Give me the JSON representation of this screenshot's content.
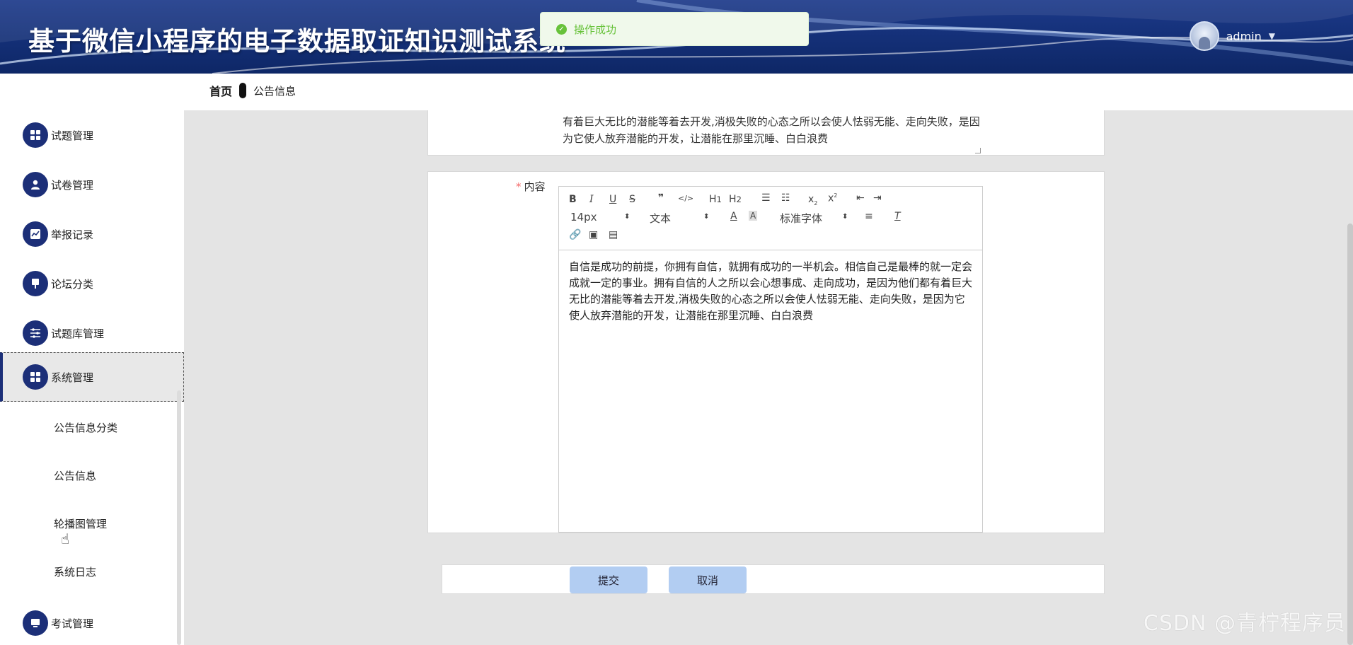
{
  "header": {
    "title": "基于微信小程序的电子数据取证知识测试系统",
    "username": "admin"
  },
  "toast": {
    "message": "操作成功"
  },
  "breadcrumb": {
    "home": "首页",
    "current": "公告信息"
  },
  "sidebar": {
    "items": [
      {
        "label": "试题管理",
        "icon": "grid-icon"
      },
      {
        "label": "试卷管理",
        "icon": "user-icon"
      },
      {
        "label": "举报记录",
        "icon": "chart-icon"
      },
      {
        "label": "论坛分类",
        "icon": "pin-icon"
      },
      {
        "label": "试题库管理",
        "icon": "sliders-icon"
      },
      {
        "label": "系统管理",
        "icon": "grid-icon",
        "active": true
      },
      {
        "label": "考试管理",
        "icon": "monitor-icon"
      }
    ],
    "sub_items": [
      "公告信息分类",
      "公告信息",
      "轮播图管理",
      "系统日志"
    ]
  },
  "form": {
    "prev_field_text": "有着巨大无比的潜能等着去开发,消极失败的心态之所以会使人怯弱无能、走向失败，是因为它使人放弃潜能的开发，让潜能在那里沉睡、白白浪费",
    "content_label": "内容",
    "content_required_mark": "*",
    "editor": {
      "font_size": "14px",
      "block_format": "文本",
      "font_family": "标准字体",
      "body": "自信是成功的前提，你拥有自信，就拥有成功的一半机会。相信自己是最棒的就一定会成就一定的事业。拥有自信的人之所以会心想事成、走向成功，是因为他们都有着巨大无比的潜能等着去开发,消极失败的心态之所以会使人怯弱无能、走向失败，是因为它使人放弃潜能的开发，让潜能在那里沉睡、白白浪费"
    },
    "submit_label": "提交",
    "cancel_label": "取消"
  },
  "watermark": "CSDN @青柠程序员"
}
